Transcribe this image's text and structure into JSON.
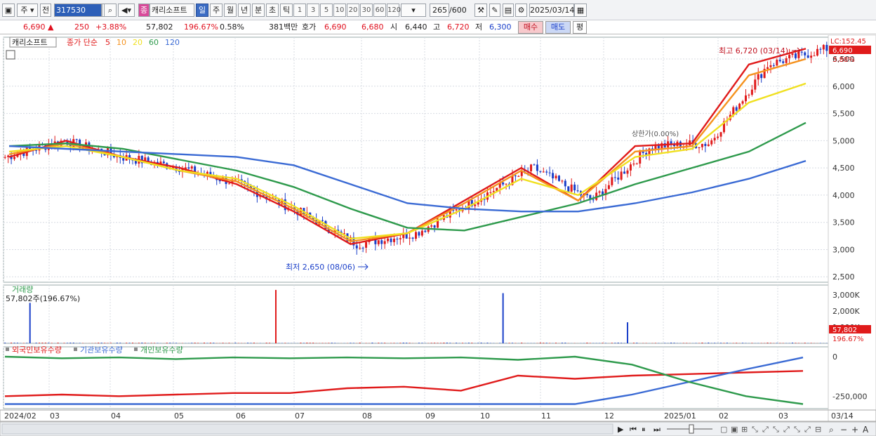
{
  "toolbar": {
    "market": "주",
    "prev_label": "전",
    "code": "317530",
    "stock_name": "캐리소프트",
    "stock_badge": "종",
    "periods": [
      "일",
      "주",
      "월",
      "년",
      "분",
      "초",
      "틱"
    ],
    "active_period": "일",
    "intervals": [
      "1",
      "3",
      "5",
      "10",
      "20",
      "30",
      "60",
      "120"
    ],
    "count": "265",
    "count_max": "/600",
    "date": "2025/03/14"
  },
  "quote": {
    "price": "6,690",
    "change_arrow": "▲",
    "change": "250",
    "change_pct": "+3.88%",
    "volume": "57,802",
    "vol_ratio": "196.67%",
    "turnover": "0.58%",
    "amount": "381백만",
    "hoga_label": "호가",
    "ask": "6,690",
    "bid": "6,680",
    "open_label": "시",
    "open": "6,440",
    "high_label": "고",
    "high": "6,720",
    "low_label": "저",
    "low": "6,300",
    "buy": "매수",
    "sell": "매도",
    "avg": "평"
  },
  "legend": {
    "name": "캐리소프트",
    "ma_label": "종가 단순",
    "periods": [
      {
        "p": "5",
        "color": "#e01b1b"
      },
      {
        "p": "10",
        "color": "#f5921e"
      },
      {
        "p": "20",
        "color": "#f0e020"
      },
      {
        "p": "60",
        "color": "#2e9a4c"
      },
      {
        "p": "120",
        "color": "#3a6ad4"
      }
    ]
  },
  "annotations": {
    "high": "최고 6,720 (03/14)",
    "low": "최저 2,650 (08/06)",
    "mid": "상한가(0.00%)",
    "lc": "LC:152.45",
    "last_price": "6,690",
    "last_pct": "3.88%"
  },
  "price_axis": [
    "6,500",
    "6,000",
    "5,500",
    "5,000",
    "4,500",
    "4,000",
    "3,500",
    "3,000",
    "2,500"
  ],
  "volume_panel": {
    "title": "거래량",
    "current": "57,802주(196.67%)",
    "axis": [
      "3,000K",
      "2,000K",
      "1,000K"
    ],
    "last": "57,802",
    "last_pct": "196.67%"
  },
  "holding_panel": {
    "series": [
      {
        "name": "외국인보유수량",
        "color": "#e01b1b"
      },
      {
        "name": "기관보유수량",
        "color": "#3a6ad4"
      },
      {
        "name": "개인보유수량",
        "color": "#2e9a4c"
      }
    ],
    "axis": [
      "0",
      "-250,000"
    ]
  },
  "time_axis": [
    "2024/02",
    "03",
    "04",
    "05",
    "06",
    "07",
    "08",
    "09",
    "10",
    "11",
    "12",
    "2025/01",
    "02",
    "03",
    "03/14"
  ],
  "chart_data": {
    "type": "line",
    "title": "캐리소프트",
    "x": [
      "2024/02",
      "03",
      "04",
      "05",
      "06",
      "07",
      "08",
      "09",
      "10",
      "11",
      "12",
      "2025/01",
      "02",
      "03",
      "03/14"
    ],
    "series": [
      {
        "name": "5",
        "values": [
          4700,
          5000,
          4700,
          4500,
          4200,
          3700,
          3100,
          3300,
          3900,
          4500,
          3900,
          4900,
          4950,
          6400,
          6690
        ]
      },
      {
        "name": "10",
        "values": [
          4750,
          4950,
          4700,
          4450,
          4250,
          3750,
          3150,
          3300,
          3850,
          4450,
          3900,
          4800,
          4900,
          6200,
          6500
        ]
      },
      {
        "name": "20",
        "values": [
          4800,
          4900,
          4700,
          4450,
          4300,
          3800,
          3200,
          3300,
          3750,
          4300,
          4000,
          4700,
          4850,
          5700,
          6050
        ]
      },
      {
        "name": "60",
        "values": [
          4900,
          4950,
          4850,
          4650,
          4450,
          4150,
          3750,
          3400,
          3350,
          3600,
          3850,
          4200,
          4500,
          4800,
          5330
        ]
      },
      {
        "name": "120",
        "values": [
          4900,
          4850,
          4800,
          4750,
          4700,
          4550,
          4200,
          3850,
          3750,
          3700,
          3700,
          3850,
          4050,
          4300,
          4630
        ]
      }
    ],
    "ylim": [
      2400,
      6900
    ],
    "annotations": [
      "최고 6,720 (03/14)",
      "최저 2,650 (08/06)"
    ]
  },
  "ui": {
    "scroll_icons": [
      "play-icon",
      "rewind-icon",
      "pause-icon",
      "fast-forward-icon"
    ],
    "zoom_icons": [
      "search-icon",
      "minus-icon",
      "plus-icon",
      "font-icon"
    ]
  }
}
